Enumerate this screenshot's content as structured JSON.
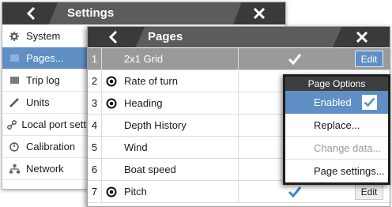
{
  "settings": {
    "title": "Settings",
    "menu": [
      {
        "label": "System",
        "icon": "gear-icon"
      },
      {
        "label": "Pages...",
        "icon": "pages-icon",
        "selected": true
      },
      {
        "label": "Trip log",
        "icon": "trip-log-icon"
      },
      {
        "label": "Units",
        "icon": "units-icon"
      },
      {
        "label": "Local port settings",
        "icon": "local-port-icon"
      },
      {
        "label": "Calibration",
        "icon": "calibration-icon"
      },
      {
        "label": "Network",
        "icon": "network-icon"
      }
    ]
  },
  "pages": {
    "title": "Pages",
    "rows": [
      {
        "num": "1",
        "name": "2x1 Grid",
        "has_icon": false,
        "checked": true,
        "edit": "Edit",
        "selected": true
      },
      {
        "num": "2",
        "name": "Rate of turn",
        "has_icon": true
      },
      {
        "num": "3",
        "name": "Heading",
        "has_icon": true
      },
      {
        "num": "4",
        "name": "Depth History",
        "has_icon": false
      },
      {
        "num": "5",
        "name": "Wind",
        "has_icon": false
      },
      {
        "num": "6",
        "name": "Boat speed",
        "has_icon": false
      },
      {
        "num": "7",
        "name": "Pitch",
        "has_icon": true,
        "checked": true,
        "edit": "Edit"
      }
    ]
  },
  "page_options": {
    "title": "Page Options",
    "items": [
      {
        "label": "Enabled",
        "selected": true,
        "checked": true
      },
      {
        "label": "Replace..."
      },
      {
        "label": "Change data...",
        "disabled": true
      },
      {
        "label": "Page settings..."
      }
    ]
  },
  "colors": {
    "accent": "#5f8fc4",
    "titlebar": "#5c5c5c",
    "titlebar_button": "#3a3a3a",
    "selected_row": "#9a9a9a"
  }
}
